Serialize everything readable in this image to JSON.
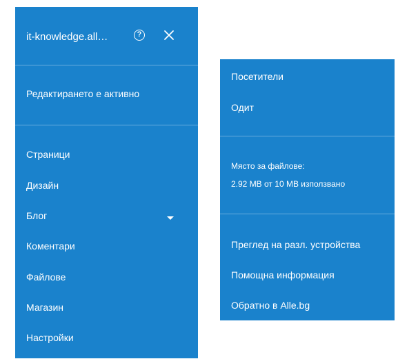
{
  "left_panel": {
    "site_name": "it-knowledge.all…",
    "help_symbol": "?",
    "help_icon": "question-circle-icon",
    "close_icon": "close-x-icon",
    "editing_status": "Редактирането е активно",
    "menu": [
      {
        "label": "Страници"
      },
      {
        "label": "Дизайн"
      },
      {
        "label": "Блог",
        "expandable": true,
        "icon": "caret-down-icon"
      },
      {
        "label": "Коментари"
      },
      {
        "label": "Файлове"
      },
      {
        "label": "Магазин"
      },
      {
        "label": "Настройки"
      }
    ]
  },
  "right_panel": {
    "top_items": [
      {
        "label": "Посетители"
      },
      {
        "label": "Одит"
      }
    ],
    "storage": {
      "label": "Място за файлове:",
      "usage": "2.92 MB от 10 MB използвано",
      "used_mb": 2.92,
      "total_mb": 10
    },
    "bottom_items": [
      {
        "label": "Преглед на разл. устройства"
      },
      {
        "label": "Помощна информация"
      },
      {
        "label": "Обратно в Alle.bg"
      }
    ]
  },
  "colors": {
    "panel_bg": "#1a82cc",
    "text": "#ffffff",
    "page_bg": "#ffffff"
  }
}
